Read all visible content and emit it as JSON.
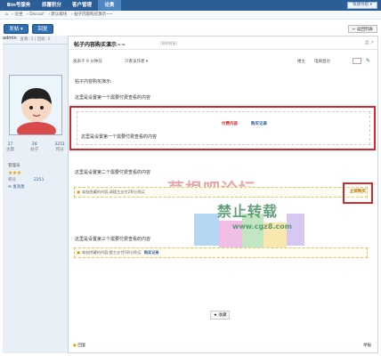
{
  "nav": {
    "tabs": [
      "Bin号服务",
      "抓覆积分",
      "客户管理",
      "论贵"
    ],
    "quick_nav": "快速导航 ▾"
  },
  "breadcrumb": [
    "⌂",
    "› 论坐",
    "› Discuz!",
    "› 默认版块",
    "› 帖子内容购买演示~~"
  ],
  "actions": {
    "post": "发帖 ▾",
    "reply": "回复",
    "back": "← 返回列表"
  },
  "sidebar": {
    "counts": "查看: 3  |  回复: 0",
    "username": "admin",
    "stats": [
      {
        "value": "27",
        "label": "主题"
      },
      {
        "value": "28",
        "label": "帖子"
      },
      {
        "value": "2251",
        "label": "积分"
      }
    ],
    "role": "管理员",
    "stars": "★★★",
    "points_label": "积分",
    "points_value": "2251",
    "send_message": "✉ 发消息"
  },
  "post": {
    "title": "帖子内容购买演示~~",
    "copy_link": "[复制链接]",
    "icons": "⎙  ↗",
    "posted": "发表于 9 分钟前",
    "only_author": "只看该作者 ▾",
    "floor": "楼主",
    "jump": "电梯直达",
    "intro": "帖子内容购买演示:",
    "line1": "这里是设置第一个需要付费查看的内容",
    "paid_label": "付费内容",
    "buy_record": "购买记录",
    "box1_content": "这里是设置第一个需要付费查看的内容",
    "line2": "这里是设置第二个需要付费查看的内容",
    "notice2": "本帖隐藏的内容,请楼主支付2积分购买",
    "buy_now": "立即购买",
    "line3": "这里是设置第三个需要付费查看的内容",
    "notice3": "本帖隐藏的内容,楼主支付5积分购买",
    "notice3_record": "购买记录",
    "favorite": "★ 收藏",
    "reply": "回复",
    "report": "举报"
  },
  "watermark": {
    "main": "草根吧论坛",
    "sub": "禁止转载",
    "url": "www.cgz8.com"
  },
  "colors": {
    "nav": "#2b5d97",
    "highlight_red": "#d02a2a",
    "link_blue": "#2b5d97"
  }
}
